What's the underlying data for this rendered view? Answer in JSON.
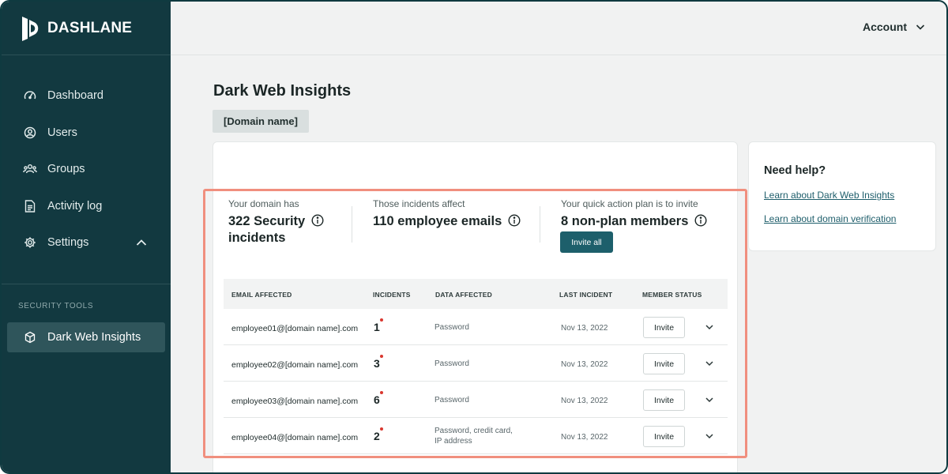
{
  "brand": {
    "name": "DASHLANE"
  },
  "sidebar": {
    "items": [
      {
        "label": "Dashboard",
        "icon": "gauge-icon"
      },
      {
        "label": "Users",
        "icon": "user-circle-icon"
      },
      {
        "label": "Groups",
        "icon": "users-icon"
      },
      {
        "label": "Activity log",
        "icon": "document-icon"
      },
      {
        "label": "Settings",
        "icon": "gear-icon"
      }
    ],
    "section_label": "SECURITY TOOLS",
    "active_item": {
      "label": "Dark Web Insights",
      "icon": "dark-web-icon"
    }
  },
  "header": {
    "account_label": "Account"
  },
  "main": {
    "title": "Dark Web Insights",
    "domain_chip": "[Domain name]",
    "stats": [
      {
        "label": "Your domain has",
        "value_line1": "322 Security",
        "value_line2": "incidents"
      },
      {
        "label": "Those incidents affect",
        "value": "110 employee emails"
      },
      {
        "label": "Your quick action plan is to invite",
        "value": "8 non-plan members"
      }
    ],
    "invite_all_label": "Invite all",
    "table": {
      "columns": [
        "EMAIL AFFECTED",
        "INCIDENTS",
        "DATA AFFECTED",
        "LAST INCIDENT",
        "MEMBER STATUS"
      ],
      "rows": [
        {
          "email": "employee01@[domain name].com",
          "incidents": "1",
          "data_line1": "Password",
          "data_line2": "",
          "last_incident": "Nov 13, 2022",
          "action": "Invite"
        },
        {
          "email": "employee02@[domain name].com",
          "incidents": "3",
          "data_line1": "Password",
          "data_line2": "",
          "last_incident": "Nov 13, 2022",
          "action": "Invite"
        },
        {
          "email": "employee03@[domain name].com",
          "incidents": "6",
          "data_line1": "Password",
          "data_line2": "",
          "last_incident": "Nov 13, 2022",
          "action": "Invite"
        },
        {
          "email": "employee04@[domain name].com",
          "incidents": "2",
          "data_line1": "Password, credit card,",
          "data_line2": "IP address",
          "last_incident": "Nov 13, 2022",
          "action": "Invite"
        }
      ]
    }
  },
  "help": {
    "title": "Need help?",
    "links": [
      "Learn about Dark Web Insights",
      "Learn about domain verification"
    ]
  },
  "colors": {
    "sidebar_bg": "#123940",
    "accent": "#1d5f6b",
    "highlight_border": "#f08f7e",
    "incident_dot": "#d9372f"
  }
}
